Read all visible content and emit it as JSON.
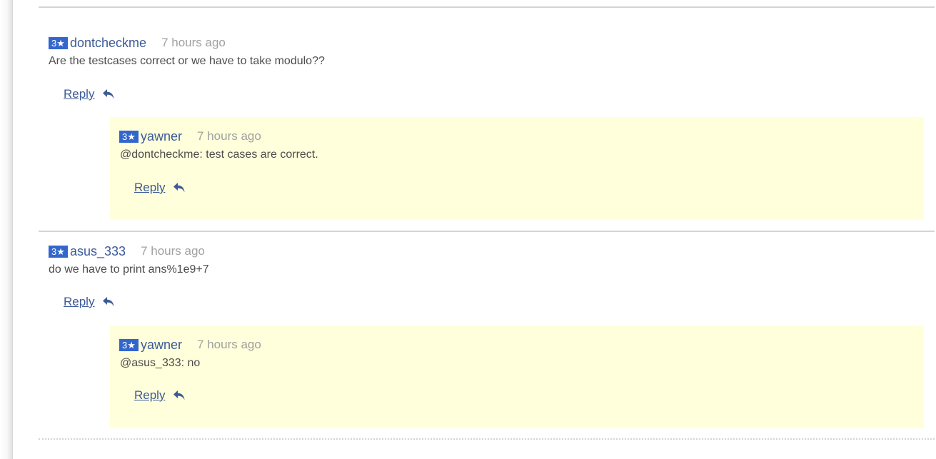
{
  "comments": [
    {
      "rating": "3★",
      "username": "dontcheckme",
      "time": "7 hours ago",
      "text": "Are the testcases correct or we have to take modulo??",
      "reply_label": "Reply",
      "replies": [
        {
          "rating": "3★",
          "username": "yawner",
          "time": "7 hours ago",
          "text": "@dontcheckme: test cases are correct.",
          "reply_label": "Reply"
        }
      ]
    },
    {
      "rating": "3★",
      "username": "asus_333",
      "time": "7 hours ago",
      "text": "do we have to print ans%1e9+7",
      "reply_label": "Reply",
      "replies": [
        {
          "rating": "3★",
          "username": "yawner",
          "time": "7 hours ago",
          "text": "@asus_333: no",
          "reply_label": "Reply"
        }
      ]
    }
  ],
  "colors": {
    "badge": "#3366cc",
    "link": "#3b5a99",
    "reply_background": "#ffffdb",
    "timestamp": "#a0a0a0",
    "text": "#4c4c4c"
  },
  "icons": {
    "reply": "reply-arrow-icon"
  }
}
